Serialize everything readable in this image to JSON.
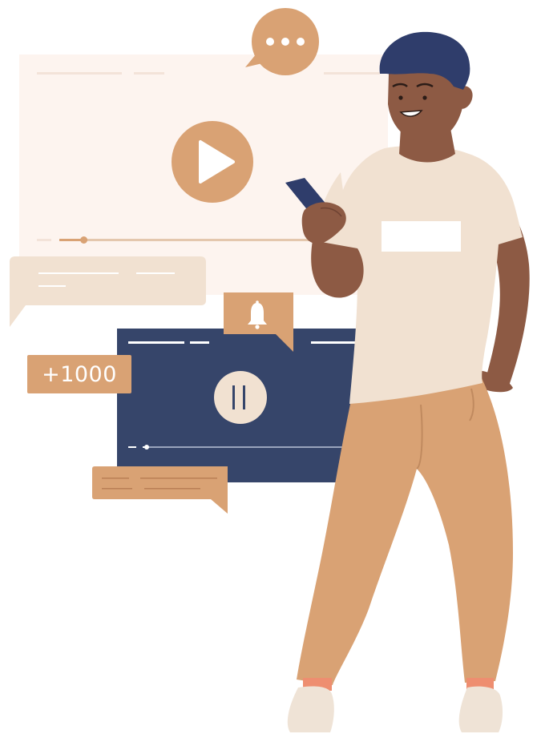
{
  "likes_badge": {
    "text": "+1000"
  },
  "colors": {
    "light_panel": "#fdf4ef",
    "dark_panel": "#36456a",
    "accent_orange": "#d9a274",
    "beige": "#f1e1d1",
    "skin": "#8d5a44",
    "hair": "#2f3d6b",
    "pants": "#d9a274",
    "shirt": "#f1e1d1",
    "shoes": "#efe3d6",
    "socks": "#ee8e70"
  },
  "icons": {
    "play": "play-icon",
    "pause": "pause-icon",
    "bell": "bell-icon",
    "ellipsis": "ellipsis-icon",
    "phone": "phone-icon"
  },
  "video_progress": {
    "light_player_fraction": 0.09,
    "dark_player_fraction": 0.02
  }
}
